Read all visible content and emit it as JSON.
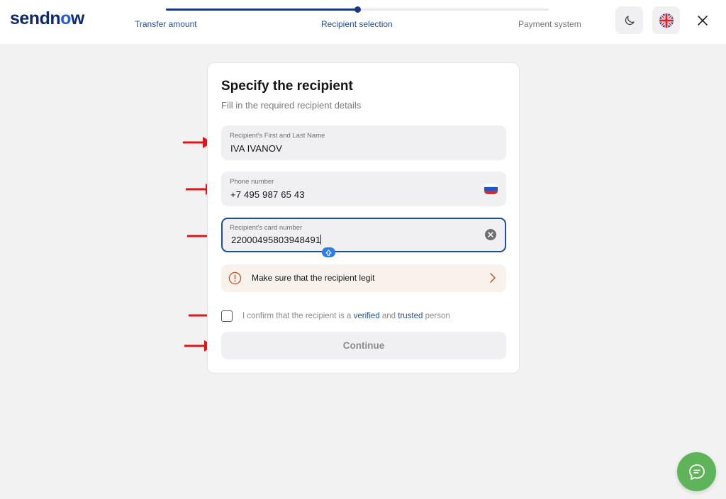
{
  "header": {
    "logo": {
      "part1": "sendn",
      "part2": "o",
      "part3": "w"
    },
    "steps": [
      {
        "label": "Transfer amount",
        "state": "done"
      },
      {
        "label": "Recipient selection",
        "state": "current"
      },
      {
        "label": "Payment system",
        "state": "upcoming"
      }
    ],
    "progress_fraction": 0.5,
    "theme_icon": "moon-icon",
    "language_icon": "uk-flag-icon",
    "close_icon": "close-icon"
  },
  "form": {
    "title": "Specify the recipient",
    "subtitle": "Fill in the required recipient details",
    "name_field": {
      "label": "Recipient's First and Last Name",
      "value": "IVA IVANOV"
    },
    "phone_field": {
      "label": "Phone number",
      "value": "+7 495 987 65 43",
      "country_icon": "russia-flag-icon"
    },
    "card_field": {
      "label": "Recipient's card number",
      "value": "22000495803948491",
      "clear_icon": "clear-icon"
    },
    "warning": {
      "text": "Make sure that the recipient legit",
      "icon": "alert-circle-icon"
    },
    "confirm": {
      "prefix": "I confirm that the recipient is a ",
      "link1": "verified",
      "middle": " and ",
      "link2": "trusted",
      "suffix": " person",
      "checked": false
    },
    "continue_label": "Continue"
  },
  "colors": {
    "brand_navy": "#0f2a66",
    "accent_blue": "#1f4f9c",
    "annotation_red": "#e0161b",
    "chat_green": "#5fb45a"
  },
  "chat": {
    "icon": "chat-bubble-icon"
  }
}
